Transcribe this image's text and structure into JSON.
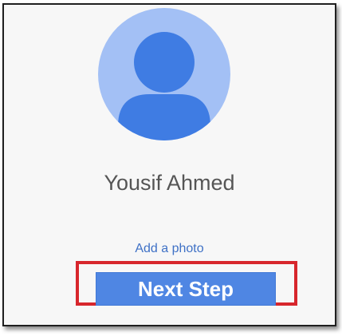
{
  "profile": {
    "name": "Yousif Ahmed",
    "avatar_icon": "person-silhouette-icon",
    "add_photo_label": "Add a photo"
  },
  "actions": {
    "next_label": "Next Step"
  },
  "colors": {
    "avatar_background": "#a3c0f5",
    "avatar_figure": "#3f7ce3",
    "link": "#3f71c6",
    "button_background": "#4f86e3",
    "button_text": "#ffffff",
    "highlight": "#d7262c"
  }
}
